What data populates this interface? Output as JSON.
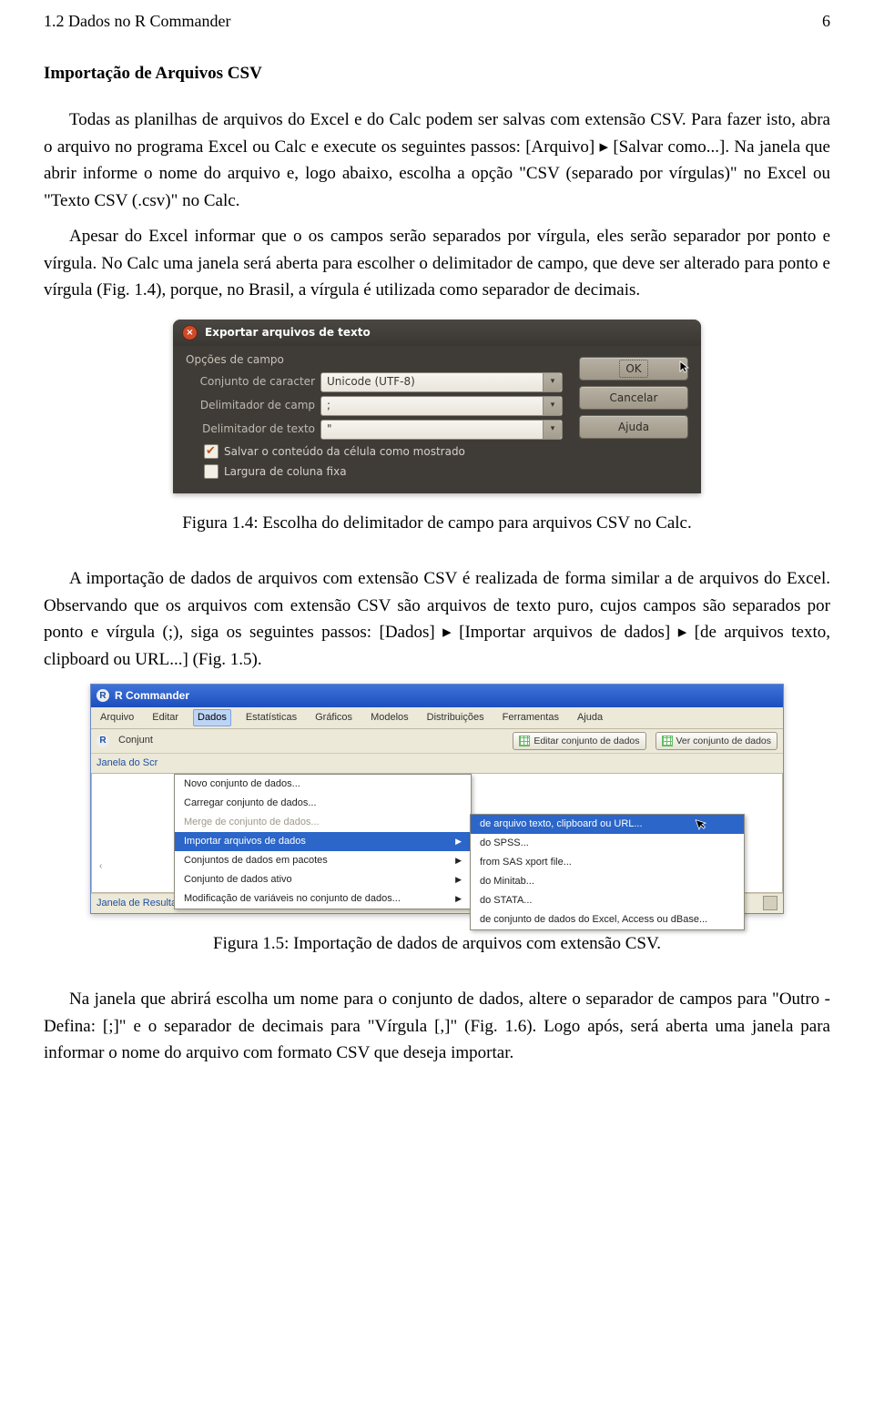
{
  "header": {
    "left": "1.2 Dados no R Commander",
    "right": "6"
  },
  "title1": "Importação de Arquivos CSV",
  "para1": "Todas as planilhas de arquivos do Excel e do Calc podem ser salvas com extensão CSV. Para fazer isto, abra o arquivo no programa Excel ou Calc e execute os seguintes passos: [Arquivo] ▸ [Salvar como...]. Na janela que abrir informe o nome do arquivo e, logo abaixo, escolha a opção \"CSV (separado por vírgulas)\" no Excel ou \"Texto CSV (.csv)\" no Calc.",
  "para2": "Apesar do Excel informar que o os campos serão separados por vírgula, eles serão separador por ponto e vírgula. No Calc uma janela será aberta para escolher o delimitador de campo, que deve ser alterado para ponto e vírgula (Fig. 1.4), porque, no Brasil, a vírgula é utilizada como separador de decimais.",
  "dlg1": {
    "title": "Exportar arquivos de texto",
    "group": "Opções de campo",
    "row_charset_lbl": "Conjunto de caracter",
    "row_charset_val": "Unicode (UTF-8)",
    "row_delim_lbl": "Delimitador de camp",
    "row_delim_val": ";",
    "row_textdelim_lbl": "Delimitador de texto",
    "row_textdelim_val": "\"",
    "chk1": "Salvar o conteúdo da célula como mostrado",
    "chk2": "Largura de coluna fixa",
    "btn_ok": "OK",
    "btn_cancel": "Cancelar",
    "btn_help": "Ajuda"
  },
  "caption1": "Figura 1.4: Escolha do delimitador de campo para arquivos CSV no Calc.",
  "para3": "A importação de dados de arquivos com extensão CSV é realizada de forma similar a de arquivos do Excel. Observando que os arquivos com extensão CSV são arquivos de texto puro, cujos campos são separados por ponto e vírgula (;), siga os seguintes passos: [Dados] ▸ [Importar arquivos de dados] ▸ [de arquivos texto, clipboard ou URL...] (Fig. 1.5).",
  "dlg2": {
    "title": "R Commander",
    "menubar": [
      "Arquivo",
      "Editar",
      "Dados",
      "Estatísticas",
      "Gráficos",
      "Modelos",
      "Distribuições",
      "Ferramentas",
      "Ajuda"
    ],
    "toolbar": {
      "datasetLabel": "Conjunt",
      "editBtn": "Editar conjunto de dados",
      "viewBtn": "Ver conjunto de dados"
    },
    "scriptLabel": "Janela do Scr",
    "dropdown1": [
      {
        "label": "Novo conjunto de dados...",
        "disabled": false,
        "sub": false
      },
      {
        "label": "Carregar conjunto de dados...",
        "disabled": false,
        "sub": false
      },
      {
        "label": "Merge de conjunto de dados...",
        "disabled": true,
        "sub": false
      },
      {
        "label": "Importar arquivos de dados",
        "disabled": false,
        "sub": true,
        "hi": true
      },
      {
        "label": "Conjuntos de dados em pacotes",
        "disabled": false,
        "sub": true
      },
      {
        "label": "Conjunto de dados ativo",
        "disabled": false,
        "sub": true
      },
      {
        "label": "Modificação de variáveis no conjunto de dados...",
        "disabled": false,
        "sub": true
      }
    ],
    "dropdown2": [
      {
        "label": "de arquivo texto, clipboard ou URL...",
        "hi": true
      },
      {
        "label": "do SPSS..."
      },
      {
        "label": "from SAS xport file..."
      },
      {
        "label": "do Minitab..."
      },
      {
        "label": "do STATA..."
      },
      {
        "label": "de conjunto de dados do Excel, Access ou dBase..."
      }
    ],
    "resultsLabel": "Janela de Resultados"
  },
  "caption2": "Figura 1.5: Importação de dados de arquivos com extensão CSV.",
  "para4": "Na janela que abrirá escolha um nome para o conjunto de dados, altere o separador de campos para \"Outro - Defina: [;]\" e o separador de decimais para \"Vírgula [,]\" (Fig. 1.6). Logo após, será aberta uma janela para informar o nome do arquivo com formato CSV que deseja importar."
}
